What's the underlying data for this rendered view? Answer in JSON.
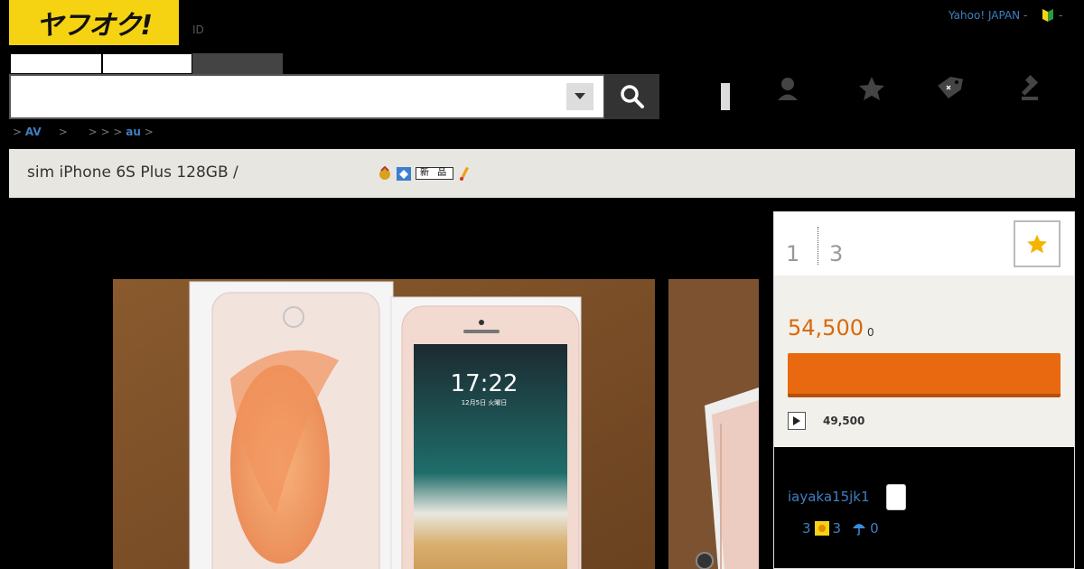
{
  "header": {
    "logo_text": "ヤフオク!",
    "id_label": "ID",
    "yahoo_link": "Yahoo! JAPAN",
    "yahoo_sep": "-",
    "trailing_dash": "-"
  },
  "search": {
    "value": "",
    "placeholder": ""
  },
  "breadcrumb": {
    "pre1": "> ",
    "item1": "AV",
    "mid": "     >      > > > ",
    "item2": "au",
    "post": " >"
  },
  "listing": {
    "title": "sim iPhone 6S Plus 128GB /",
    "new_badge": "新 品",
    "bid_count": "1",
    "watch_count": "3",
    "price": "54,500",
    "price_unit": "0",
    "buy_now_price": "49,500"
  },
  "seller": {
    "name": "iayaka15jk1",
    "rating_total": "3",
    "rating_good": "3",
    "rating_bad": "0"
  },
  "photo": {
    "clock_time": "17:22",
    "clock_date": "12月5日 火曜日"
  },
  "colors": {
    "logo_yellow": "#f5d313",
    "accent_orange": "#e8690f",
    "price_orange": "#d9690b",
    "link_blue": "#3e7fc1"
  },
  "icons": {
    "search": "search-icon",
    "dropdown": "chevron-down-icon",
    "user": "user-icon",
    "star": "star-icon",
    "tag": "tag-icon",
    "gavel": "gavel-icon",
    "beginner": "beginner-mark-icon"
  }
}
